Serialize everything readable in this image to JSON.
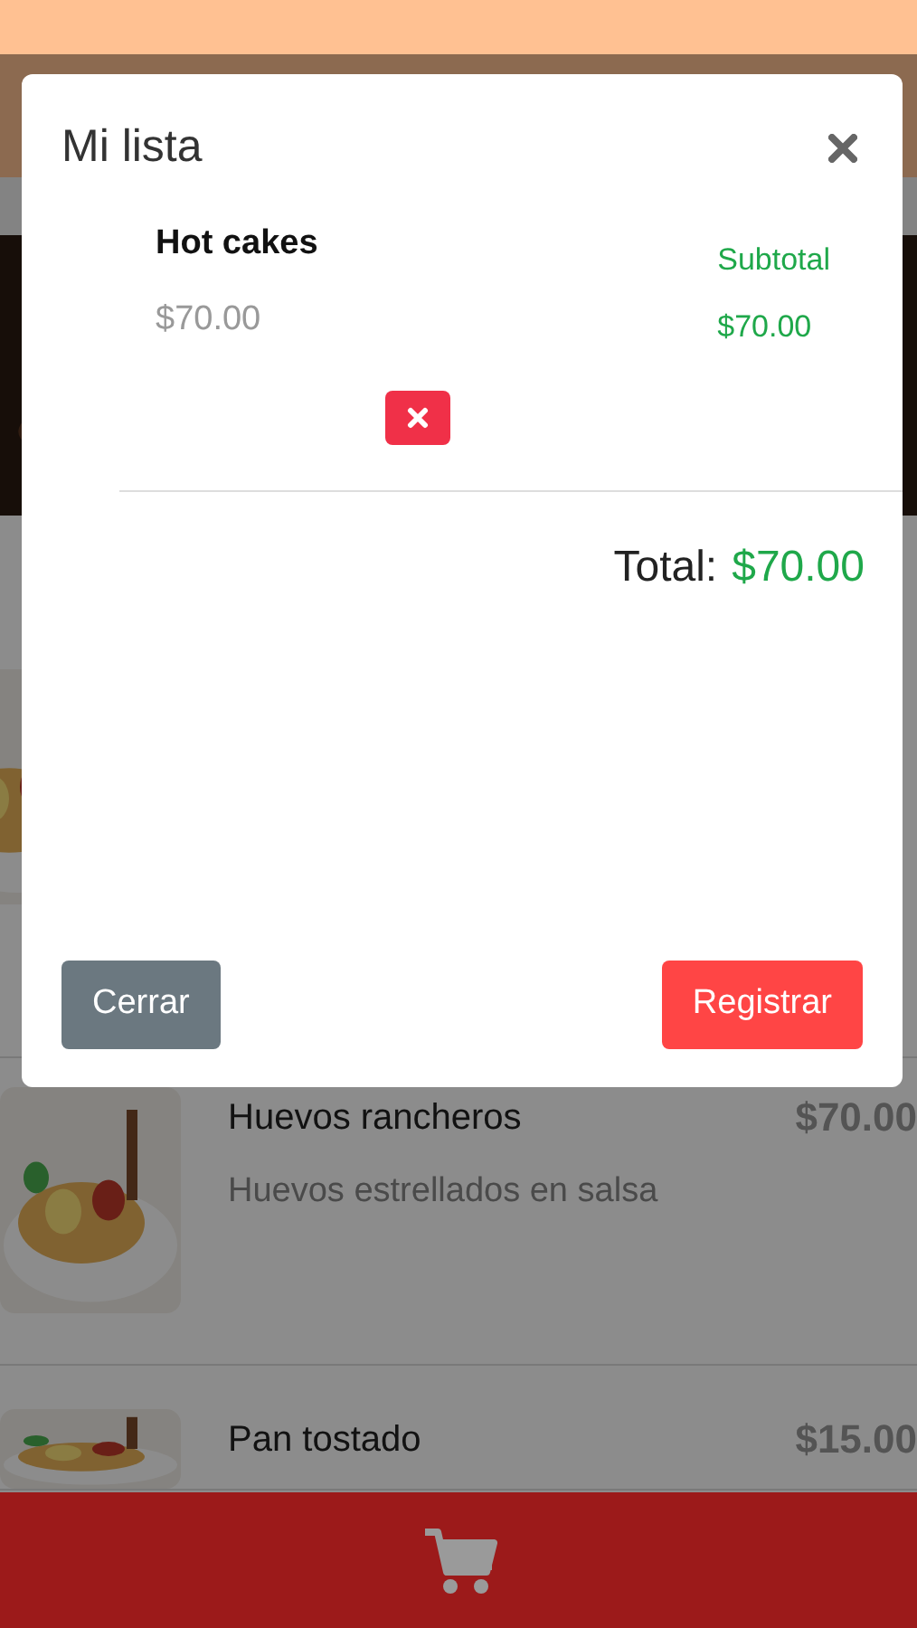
{
  "menu_items": [
    {
      "name": "Huevos rancheros",
      "price": "$70.00",
      "description": "Huevos estrellados en salsa"
    },
    {
      "name": "Pan tostado",
      "price": "$15.00"
    }
  ],
  "modal": {
    "title": "Mi lista",
    "items": [
      {
        "name": "Hot cakes",
        "price": "$70.00",
        "subtotal_label": "Subtotal",
        "subtotal": "$70.00"
      }
    ],
    "total_label": "Total:",
    "total": "$70.00",
    "buttons": [
      {
        "label": "Cerrar",
        "kind": "secondary"
      },
      {
        "label": "Registrar",
        "kind": "primary"
      }
    ]
  }
}
